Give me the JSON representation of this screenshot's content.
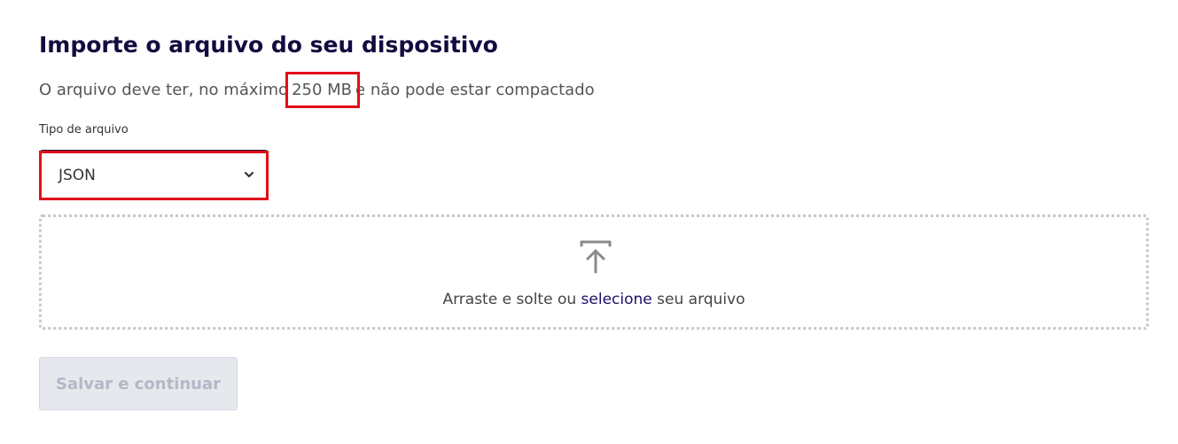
{
  "header": {
    "title": "Importe o arquivo do seu dispositivo",
    "subtitle_before": "O arquivo deve ter, no máximo",
    "subtitle_size": "250 MB",
    "subtitle_after": "e não pode estar compactado"
  },
  "file_type": {
    "label": "Tipo de arquivo",
    "selected": "JSON",
    "icon": "chevron-down-icon"
  },
  "dropzone": {
    "icon": "upload-icon",
    "text_before": "Arraste e solte ou",
    "link_label": "selecione",
    "text_after": "seu arquivo"
  },
  "actions": {
    "save_label": "Salvar e continuar",
    "save_disabled": true
  },
  "colors": {
    "title": "#130b3f",
    "link": "#1e0e6b",
    "highlight_annotation": "#e10f18",
    "button_disabled_bg": "#e6e8ee",
    "button_disabled_text": "#b4b8c6"
  }
}
